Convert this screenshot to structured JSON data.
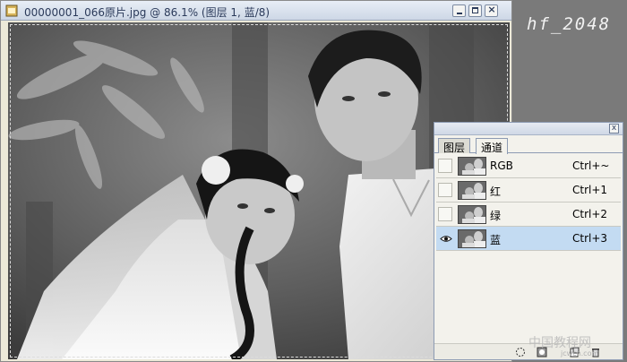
{
  "document": {
    "title": "00000001_066原片.jpg @ 86.1% (图层 1, 蓝/8)"
  },
  "watermarks": {
    "top": "hf_2048",
    "bottom": "中国教程网",
    "bottom_sub": "jcwcn.com"
  },
  "channels_panel": {
    "tabs": [
      {
        "label": "图层",
        "active": false
      },
      {
        "label": "通道",
        "active": true
      }
    ],
    "menu_icon": "»",
    "close_icon": "x",
    "channels": [
      {
        "name": "RGB",
        "shortcut": "Ctrl+~",
        "visible": false,
        "selected": false
      },
      {
        "name": "红",
        "shortcut": "Ctrl+1",
        "visible": false,
        "selected": false
      },
      {
        "name": "绿",
        "shortcut": "Ctrl+2",
        "visible": false,
        "selected": false
      },
      {
        "name": "蓝",
        "shortcut": "Ctrl+3",
        "visible": true,
        "selected": true
      }
    ],
    "bottom_icons": [
      "load-selection-icon",
      "save-selection-icon",
      "new-channel-icon",
      "trash-icon"
    ]
  },
  "colors": {
    "selected_row": "#c3dbf2",
    "titlebar": "#cdd7e6"
  }
}
